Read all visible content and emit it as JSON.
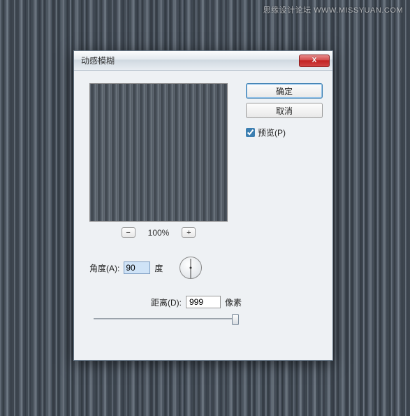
{
  "watermark": "思缘设计论坛   WWW.MISSYUAN.COM",
  "dialog": {
    "title": "动感模糊",
    "close_icon": "X",
    "zoom": {
      "minus": "−",
      "level": "100%",
      "plus": "+"
    },
    "buttons": {
      "ok": "确定",
      "cancel": "取消"
    },
    "preview_checkbox": {
      "label": "预览(P)",
      "checked": true
    },
    "angle": {
      "label": "角度(A):",
      "value": "90",
      "unit": "度"
    },
    "distance": {
      "label": "距离(D):",
      "value": "999",
      "unit": "像素"
    }
  }
}
